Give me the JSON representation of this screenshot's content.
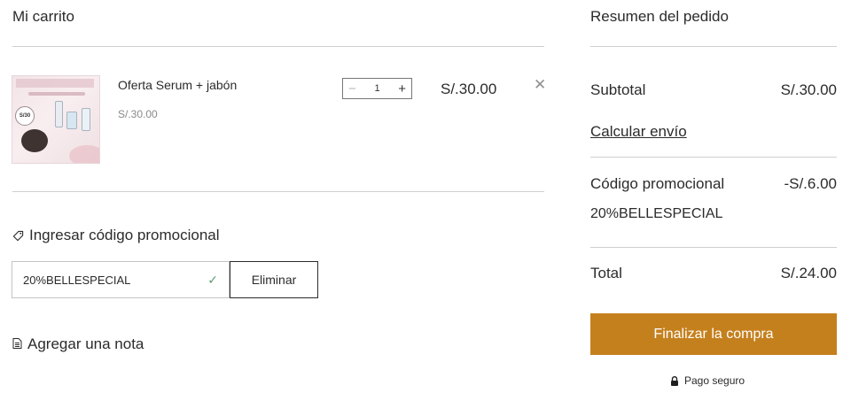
{
  "cart": {
    "title": "Mi carrito",
    "item": {
      "name": "Oferta Serum + jabón",
      "unit_price": "S/.30.00",
      "quantity": "1",
      "line_total": "S/.30.00",
      "thumbnail_badge": "S/30",
      "remove_icon": "close-icon"
    },
    "promo": {
      "toggle_label": "Ingresar código promocional",
      "input_value": "20%BELLESPECIAL",
      "remove_label": "Eliminar"
    },
    "note": {
      "label": "Agregar una nota"
    }
  },
  "summary": {
    "title": "Resumen del pedido",
    "subtotal_label": "Subtotal",
    "subtotal_value": "S/.30.00",
    "shipping_link": "Calcular envío",
    "promo_label": "Código promocional",
    "promo_value": "-S/.6.00",
    "promo_code": "20%BELLESPECIAL",
    "total_label": "Total",
    "total_value": "S/.24.00",
    "checkout_label": "Finalizar la compra",
    "secure_label": "Pago seguro"
  },
  "colors": {
    "accent": "#c5801e",
    "divider": "#cfcfcf",
    "success_check": "#5e9e6e"
  }
}
